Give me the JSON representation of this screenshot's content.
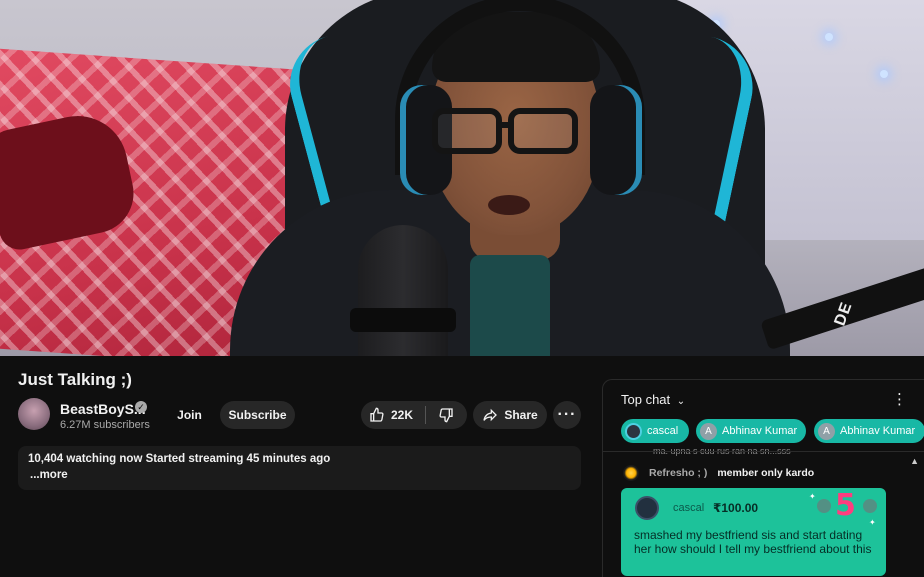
{
  "video": {
    "overlay_text": "DE"
  },
  "title": "Just Talking ;)",
  "channel": {
    "name": "BeastBoyS...",
    "subscribers": "6.27M subscribers"
  },
  "actions": {
    "join": "Join",
    "subscribe": "Subscribe",
    "likes": "22K",
    "share": "Share",
    "more": "···"
  },
  "description": {
    "stats": "10,404 watching now  Started streaming 45 minutes ago",
    "more": "...more"
  },
  "chat": {
    "header": "Top chat",
    "ticker": [
      {
        "initial": "",
        "name": "cascal"
      },
      {
        "initial": "A",
        "name": "Abhinav Kumar"
      },
      {
        "initial": "A",
        "name": "Abhinav Kumar"
      }
    ],
    "cut_off_text": "ma. upna s cuu rus ran na sn...sss",
    "messages": [
      {
        "author": "Refresho ; )",
        "text": "member only kardo"
      }
    ],
    "superchat": {
      "author": "cascal",
      "amount": "₹100.00",
      "sticker": "5",
      "text": "smashed my bestfriend sis and start dating her how should I tell my bestfriend about this",
      "color": "#1dc29a"
    }
  },
  "colors": {
    "background": "#0f0f0f",
    "accent_teal": "#18b8a5",
    "pill_bg": "#272727"
  }
}
